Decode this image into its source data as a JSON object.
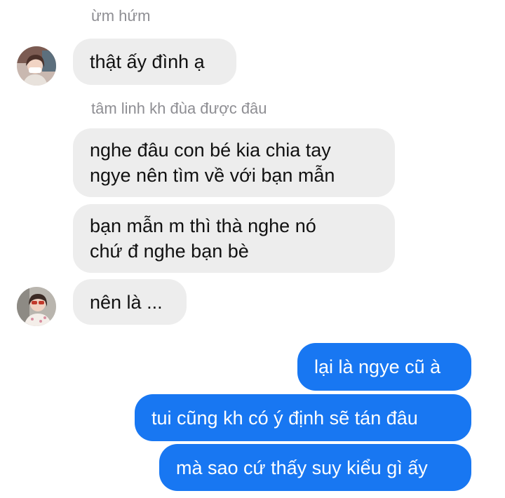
{
  "conversation": {
    "reply_context_1": "ừm hứm",
    "reply_context_2": "tâm linh kh đùa được đâu",
    "incoming": [
      {
        "text": "thật ấy đình ạ"
      },
      {
        "lines": [
          "nghe đâu con bé kia chia tay",
          "ngye nên tìm về với bạn mẫn"
        ]
      },
      {
        "lines": [
          "bạn mẫn m thì thà nghe nó",
          "chứ đ nghe bạn bè"
        ]
      },
      {
        "text": "nên là ..."
      }
    ],
    "outgoing": [
      {
        "text": "lại là ngye cũ à"
      },
      {
        "text": "tui cũng kh có ý định sẽ tán đâu"
      },
      {
        "text": "mà sao cứ thấy suy kiểu gì ấy"
      }
    ]
  },
  "colors": {
    "incoming_bubble": "#ededed",
    "outgoing_bubble": "#1877f2",
    "reply_label": "#8e8e93"
  },
  "icons": {
    "avatar_1": "contact-avatar-photo",
    "avatar_2": "contact-avatar-photo"
  }
}
